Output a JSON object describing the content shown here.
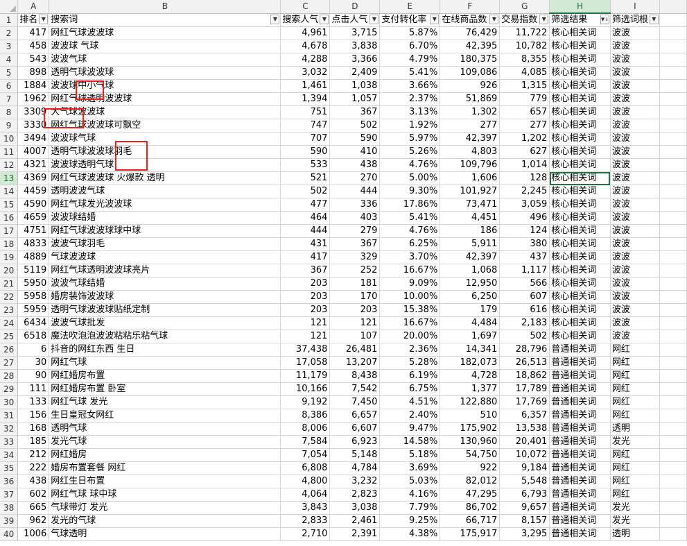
{
  "columns": [
    "A",
    "B",
    "C",
    "D",
    "E",
    "F",
    "G",
    "H",
    "I"
  ],
  "selected_column": "H",
  "header_row": [
    "排名",
    "搜索词",
    "搜索人气",
    "点击人气",
    "支付转化率",
    "在线商品数",
    "交易指数",
    "筛选结果",
    "筛选词根"
  ],
  "header_icons": [
    "filter-dropdown-icon",
    "filter-dropdown-icon",
    "filter-dropdown-icon",
    "filter-dropdown-icon",
    "filter-dropdown-icon",
    "filter-dropdown-icon",
    "filter-dropdown-icon",
    "filter-sort-icon",
    "filter-dropdown-icon"
  ],
  "selected_row": 13,
  "rows": [
    [
      "417",
      "网红气球波波球",
      "4,961",
      "3,715",
      "5.87%",
      "76,429",
      "11,722",
      "核心相关词",
      "波波"
    ],
    [
      "458",
      "波波球 气球",
      "4,678",
      "3,838",
      "6.70%",
      "42,395",
      "10,782",
      "核心相关词",
      "波波"
    ],
    [
      "543",
      "波波气球",
      "4,288",
      "3,366",
      "4.79%",
      "180,375",
      "8,355",
      "核心相关词",
      "波波"
    ],
    [
      "898",
      "透明气球波波球",
      "3,032",
      "2,409",
      "5.41%",
      "109,086",
      "4,085",
      "核心相关词",
      "波波"
    ],
    [
      "1884",
      "波波球中小气球",
      "1,461",
      "1,038",
      "3.66%",
      "926",
      "1,315",
      "核心相关词",
      "波波"
    ],
    [
      "1962",
      "网红气球透明波波球",
      "1,394",
      "1,057",
      "2.37%",
      "51,869",
      "779",
      "核心相关词",
      "波波"
    ],
    [
      "3309",
      "大气球波波球",
      "751",
      "367",
      "3.13%",
      "1,302",
      "657",
      "核心相关词",
      "波波"
    ],
    [
      "3330",
      "网红气球波波球可飘空",
      "747",
      "502",
      "1.92%",
      "277",
      "277",
      "核心相关词",
      "波波"
    ],
    [
      "3494",
      "波波球气球",
      "707",
      "590",
      "5.97%",
      "42,397",
      "1,202",
      "核心相关词",
      "波波"
    ],
    [
      "4007",
      "透明气球波波球羽毛",
      "590",
      "410",
      "5.26%",
      "4,803",
      "627",
      "核心相关词",
      "波波"
    ],
    [
      "4321",
      "波波球透明气球",
      "533",
      "438",
      "4.76%",
      "109,796",
      "1,014",
      "核心相关词",
      "波波"
    ],
    [
      "4369",
      "网红气球波波球 火爆款 透明",
      "521",
      "270",
      "5.00%",
      "1,606",
      "128",
      "核心相关词",
      "波波"
    ],
    [
      "4459",
      "透明波波气球",
      "502",
      "444",
      "9.30%",
      "101,927",
      "2,245",
      "核心相关词",
      "波波"
    ],
    [
      "4590",
      "网红气球发光波波球",
      "477",
      "336",
      "17.86%",
      "73,471",
      "3,059",
      "核心相关词",
      "波波"
    ],
    [
      "4659",
      "波波球结婚",
      "464",
      "403",
      "5.41%",
      "4,451",
      "496",
      "核心相关词",
      "波波"
    ],
    [
      "4751",
      "网红气球波波球球中球",
      "444",
      "279",
      "4.76%",
      "186",
      "124",
      "核心相关词",
      "波波"
    ],
    [
      "4833",
      "波波气球羽毛",
      "431",
      "367",
      "6.25%",
      "5,911",
      "380",
      "核心相关词",
      "波波"
    ],
    [
      "4889",
      "气球波波球",
      "417",
      "329",
      "3.70%",
      "42,397",
      "437",
      "核心相关词",
      "波波"
    ],
    [
      "5119",
      "网红气球透明波波球亮片",
      "367",
      "252",
      "16.67%",
      "1,068",
      "1,117",
      "核心相关词",
      "波波"
    ],
    [
      "5950",
      "波波气球结婚",
      "203",
      "181",
      "9.09%",
      "12,950",
      "566",
      "核心相关词",
      "波波"
    ],
    [
      "5958",
      "婚房装饰波波球",
      "203",
      "170",
      "10.00%",
      "6,250",
      "607",
      "核心相关词",
      "波波"
    ],
    [
      "5959",
      "透明气球波波球贴纸定制",
      "203",
      "203",
      "15.38%",
      "179",
      "616",
      "核心相关词",
      "波波"
    ],
    [
      "6434",
      "波波气球批发",
      "121",
      "121",
      "16.67%",
      "4,484",
      "2,183",
      "核心相关词",
      "波波"
    ],
    [
      "6518",
      "魔法吹泡泡波波粘粘乐粘气球",
      "121",
      "107",
      "20.00%",
      "1,697",
      "502",
      "核心相关词",
      "波波"
    ],
    [
      "6",
      "抖音的网红东西 生日",
      "37,438",
      "26,481",
      "2.36%",
      "14,341",
      "28,796",
      "普通相关词",
      "网红"
    ],
    [
      "30",
      "网红气球",
      "17,058",
      "13,207",
      "5.28%",
      "182,073",
      "26,513",
      "普通相关词",
      "网红"
    ],
    [
      "90",
      "网红婚房布置",
      "11,179",
      "8,438",
      "6.19%",
      "4,728",
      "18,862",
      "普通相关词",
      "网红"
    ],
    [
      "111",
      "网红婚房布置 卧室",
      "10,166",
      "7,542",
      "6.75%",
      "1,377",
      "17,789",
      "普通相关词",
      "网红"
    ],
    [
      "133",
      "网红气球 发光",
      "9,192",
      "7,450",
      "4.51%",
      "122,880",
      "17,769",
      "普通相关词",
      "网红"
    ],
    [
      "156",
      "生日皇冠女网红",
      "8,386",
      "6,657",
      "2.40%",
      "510",
      "6,357",
      "普通相关词",
      "网红"
    ],
    [
      "168",
      "透明气球",
      "8,006",
      "6,607",
      "9.47%",
      "175,902",
      "13,538",
      "普通相关词",
      "透明"
    ],
    [
      "185",
      "发光气球",
      "7,584",
      "6,923",
      "14.58%",
      "130,960",
      "20,401",
      "普通相关词",
      "发光"
    ],
    [
      "212",
      "网红婚房",
      "7,054",
      "5,148",
      "5.18%",
      "54,750",
      "10,072",
      "普通相关词",
      "网红"
    ],
    [
      "222",
      "婚房布置套餐 网红",
      "6,808",
      "4,784",
      "3.69%",
      "922",
      "9,184",
      "普通相关词",
      "网红"
    ],
    [
      "438",
      "网红生日布置",
      "4,800",
      "3,232",
      "5.03%",
      "82,012",
      "5,548",
      "普通相关词",
      "网红"
    ],
    [
      "602",
      "网红气球 球中球",
      "4,064",
      "2,823",
      "4.16%",
      "47,295",
      "6,793",
      "普通相关词",
      "网红"
    ],
    [
      "665",
      "气球带灯 发光",
      "3,843",
      "3,038",
      "7.79%",
      "86,702",
      "9,657",
      "普通相关词",
      "发光"
    ],
    [
      "962",
      "发光的气球",
      "2,833",
      "2,461",
      "9.25%",
      "66,717",
      "8,157",
      "普通相关词",
      "发光"
    ],
    [
      "1006",
      "气球透明",
      "2,710",
      "2,391",
      "4.38%",
      "175,917",
      "3,295",
      "普通相关词",
      "透明"
    ]
  ]
}
